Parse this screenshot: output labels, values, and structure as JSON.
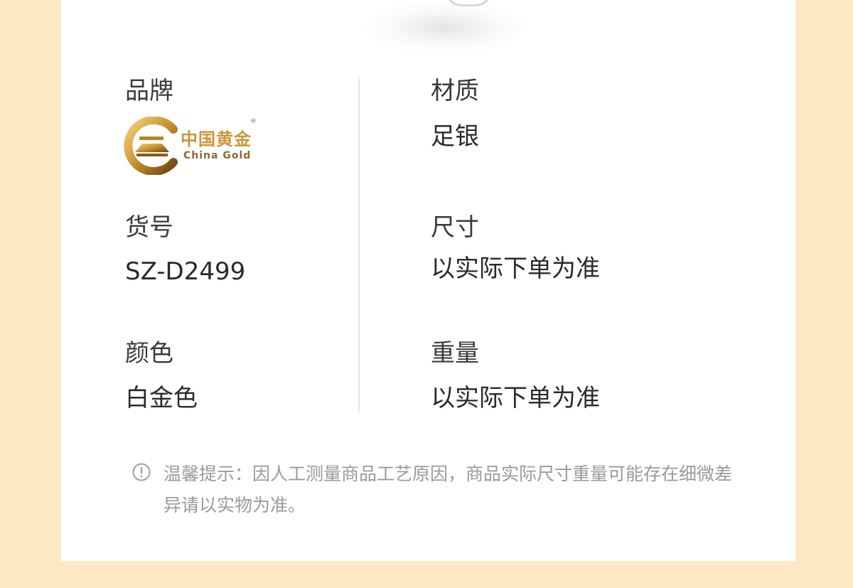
{
  "specs": {
    "brand": {
      "label": "品牌",
      "logo_cn": "中国黄金",
      "logo_en": "China Gold",
      "logo_mark": "®"
    },
    "material": {
      "label": "材质",
      "value": "足银"
    },
    "item_no": {
      "label": "货号",
      "value": "SZ-D2499"
    },
    "size": {
      "label": "尺寸",
      "value": "以实际下单为准"
    },
    "color": {
      "label": "颜色",
      "value": "白金色"
    },
    "weight": {
      "label": "重量",
      "value": "以实际下单为准"
    }
  },
  "notice": {
    "icon": "info-circle-icon",
    "text": "温馨提示：因人工测量商品工艺原因，商品实际尺寸重量可能存在细微差异请以实物为准。"
  },
  "colors": {
    "page_background": "#fde8c4",
    "card_background": "#ffffff",
    "text_primary": "#3a3a3a",
    "text_notice": "#9a9a9a",
    "logo_gold": "#c9963b"
  }
}
